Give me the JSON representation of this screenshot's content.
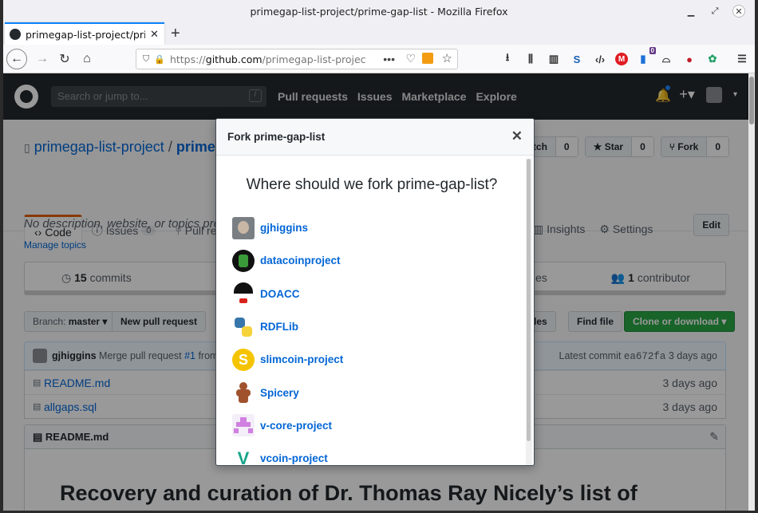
{
  "window": {
    "title": "primegap-list-project/prime-gap-list - Mozilla Firefox"
  },
  "browser": {
    "tab_title": "primegap-list-project/prime-gap-list",
    "url_scheme": "https://",
    "url_host": "github.com",
    "url_path": "/primegap-list-project/prime-gap-list",
    "notif_badge": "0"
  },
  "github": {
    "search_placeholder": "Search or jump to...",
    "search_key": "/",
    "nav": [
      "Pull requests",
      "Issues",
      "Marketplace",
      "Explore"
    ],
    "repo_owner": "primegap-list-project",
    "repo_sep": "/",
    "repo_name": "prime-gap-list",
    "watch_label": "tch",
    "watch_count": "0",
    "star_label": "Star",
    "star_count": "0",
    "fork_label": "Fork",
    "fork_count": "0",
    "tabs": {
      "code": "Code",
      "issues": "Issues",
      "issues_count": "0",
      "pulls": "Pull requests",
      "insights": "Insights",
      "settings": "Settings"
    },
    "description": "No description, website, or topics provided.",
    "manage_topics": "Manage topics",
    "edit": "Edit",
    "commits_count": "15",
    "commits_label": "commits",
    "releases_partial": "es",
    "contrib_count": "1",
    "contrib_label": "contributor",
    "branch_label": "Branch:",
    "branch_name": "master",
    "new_pr": "New pull request",
    "upload_files": "d files",
    "find_file": "Find file",
    "clone": "Clone or download",
    "commit_author": "gjhiggins",
    "commit_msg": "Merge pull request",
    "commit_pr": "#1",
    "commit_from": "from gjhig",
    "latest_label": "Latest commit",
    "latest_sha": "ea672fa",
    "latest_time": "3 days ago",
    "files": [
      {
        "name": "README.md",
        "time": "3 days ago"
      },
      {
        "name": "allgaps.sql",
        "time": "3 days ago"
      }
    ],
    "readme_title": "README.md",
    "readme_h1": "Recovery and curation of Dr. Thomas Ray Nicely’s list of"
  },
  "modal": {
    "title": "Fork prime-gap-list",
    "question": "Where should we fork prime-gap-list?",
    "orgs": [
      "gjhiggins",
      "datacoinproject",
      "DOACC",
      "RDFLib",
      "slimcoin-project",
      "Spicery",
      "v-core-project",
      "vcoin-project"
    ]
  },
  "colors": {
    "accent": "#0a84ff",
    "link": "#0366d6",
    "gh_header": "#24292e",
    "green": "#28a745",
    "tab_orange": "#e36209"
  }
}
